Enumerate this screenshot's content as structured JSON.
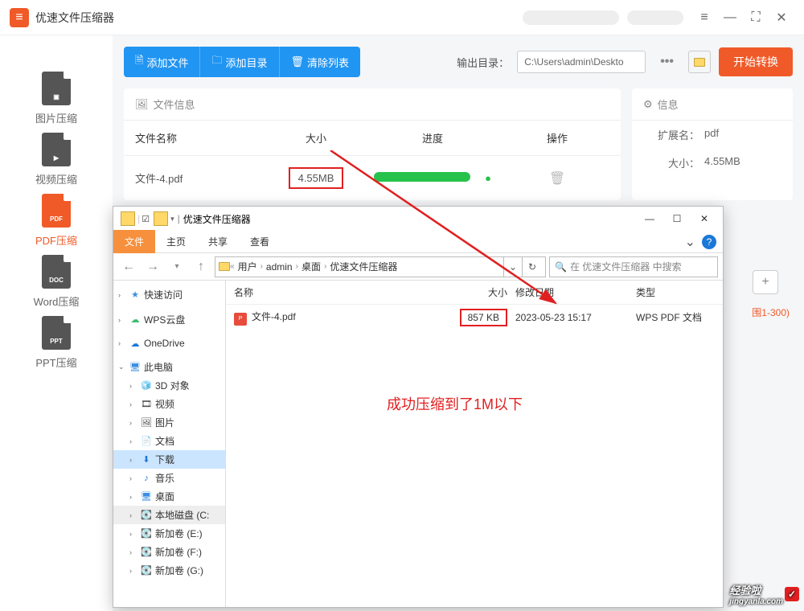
{
  "app": {
    "title": "优速文件压缩器"
  },
  "sidebar": {
    "items": [
      {
        "label": "图片压缩",
        "badge": ""
      },
      {
        "label": "视频压缩",
        "badge": ""
      },
      {
        "label": "PDF压缩",
        "badge": "PDF"
      },
      {
        "label": "Word压缩",
        "badge": "DOC"
      },
      {
        "label": "PPT压缩",
        "badge": "PPT"
      }
    ]
  },
  "toolbar": {
    "add_file": "添加文件",
    "add_dir": "添加目录",
    "clear": "清除列表",
    "out_label": "输出目录：",
    "out_path": "C:\\Users\\admin\\Deskto",
    "start": "开始转换"
  },
  "panel": {
    "file_info": "文件信息",
    "info": "信息",
    "cols": {
      "name": "文件名称",
      "size": "大小",
      "progress": "进度",
      "op": "操作"
    },
    "row": {
      "name": "文件-4.pdf",
      "size": "4.55MB"
    },
    "ext_k": "扩展名：",
    "ext_v": "pdf",
    "sz_k": "大小：",
    "sz_v": "4.55MB",
    "range_hint": "围1-300)"
  },
  "explorer": {
    "title": "优速文件压缩器",
    "tabs": {
      "file": "文件",
      "home": "主页",
      "share": "共享",
      "view": "查看"
    },
    "crumbs": [
      "用户",
      "admin",
      "桌面",
      "优速文件压缩器"
    ],
    "search_ph": "在 优速文件压缩器 中搜索",
    "cols": {
      "name": "名称",
      "size": "大小",
      "date": "修改日期",
      "type": "类型"
    },
    "row": {
      "name": "文件-4.pdf",
      "size": "857 KB",
      "date": "2023-05-23 15:17",
      "type": "WPS PDF 文档"
    },
    "tree": {
      "quick": "快速访问",
      "wps": "WPS云盘",
      "onedrive": "OneDrive",
      "pc": "此电脑",
      "pcitems": [
        "3D 对象",
        "视频",
        "图片",
        "文档",
        "下载",
        "音乐",
        "桌面",
        "本地磁盘 (C:",
        "新加卷 (E:)",
        "新加卷 (F:)",
        "新加卷 (G:)"
      ]
    },
    "msg": "成功压缩到了1M以下"
  },
  "watermark": {
    "t1": "经验啦",
    "t2": "jingyanla.com"
  }
}
